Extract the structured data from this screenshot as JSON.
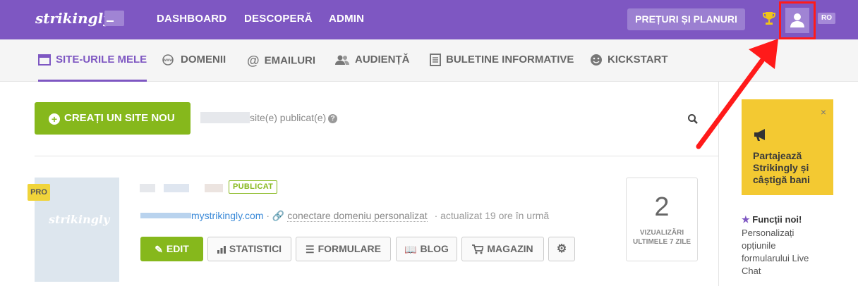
{
  "topbar": {
    "logo": "strikingly",
    "nav": [
      "DASHBOARD",
      "DESCOPERĂ",
      "ADMIN"
    ],
    "pricing_label": "PREȚURI ȘI PLANURI",
    "language": "RO",
    "colors": {
      "brand": "#7e57c2",
      "accent_green": "#86b81c",
      "promo_yellow": "#f3c932"
    }
  },
  "subnav": {
    "tabs": [
      {
        "label": "SITE-URILE MELE",
        "icon": "browser-icon"
      },
      {
        "label": "DOMENII",
        "icon": "www-icon"
      },
      {
        "label": "EMAILURI",
        "icon": "at-icon"
      },
      {
        "label": "AUDIENȚĂ",
        "icon": "users-icon"
      },
      {
        "label": "BULETINE INFORMATIVE",
        "icon": "newsletter-icon"
      },
      {
        "label": "KICKSTART",
        "icon": "smiley-icon"
      }
    ]
  },
  "main": {
    "create_label": "CREAȚI UN SITE NOU",
    "published_count_text": "site(e) publicat(e)",
    "site": {
      "badge": "PRO",
      "thumb_logo": "strikingly",
      "status": "PUBLICAT",
      "url_suffix": "mystrikingly.com",
      "connect_label": "conectare domeniu personalizat",
      "updated": "· actualizat 19 ore în urmă",
      "actions": [
        "EDIT",
        "STATISTICI",
        "FORMULARE",
        "BLOG",
        "MAGAZIN"
      ],
      "views_count": "2",
      "views_label_1": "VIZUALIZĂRI",
      "views_label_2": "ULTIMELE 7 ZILE"
    }
  },
  "sidebar": {
    "promo_text": "Partajează Strikingly și câștigă bani",
    "close": "×",
    "new_features_title": "Funcții noi!",
    "new_features_desc": "Personalizați opțiunile formularului Live Chat"
  }
}
